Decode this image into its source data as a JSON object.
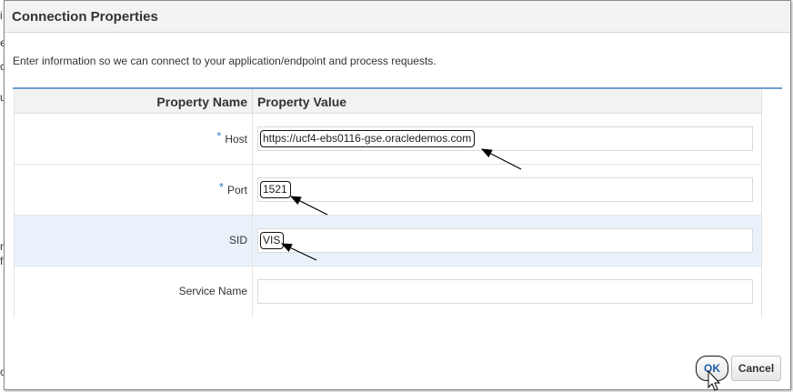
{
  "dialog": {
    "title": "Connection Properties",
    "instruction": "Enter information so we can connect to your application/endpoint and process requests."
  },
  "table": {
    "headers": {
      "name": "Property Name",
      "value": "Property Value"
    },
    "rows": [
      {
        "label": "Host",
        "required": "*",
        "value": "https://ucf4-ebs0116-gse.oracledemos.com"
      },
      {
        "label": "Port",
        "required": "*",
        "value": "1521"
      },
      {
        "label": "SID",
        "required": "",
        "value": "VIS"
      },
      {
        "label": "Service Name",
        "required": "",
        "value": ""
      }
    ]
  },
  "buttons": {
    "ok": "OK",
    "cancel": "Cancel"
  },
  "colors": {
    "accent": "#3a7bc8",
    "selected_row": "#e9f2fb",
    "separator": "#6f9fcf"
  }
}
